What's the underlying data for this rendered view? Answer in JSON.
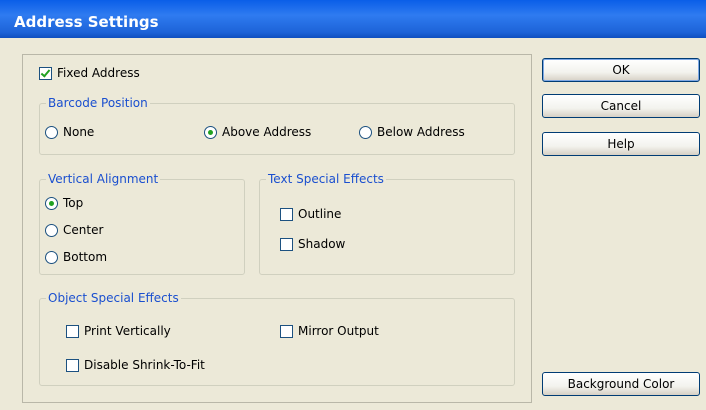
{
  "window": {
    "title": "Address Settings"
  },
  "fixed_address": {
    "label": "Fixed Address",
    "checked": true
  },
  "barcode_position": {
    "legend": "Barcode Position",
    "options": [
      {
        "label": "None",
        "checked": false
      },
      {
        "label": "Above Address",
        "checked": true
      },
      {
        "label": "Below Address",
        "checked": false
      }
    ]
  },
  "vertical_alignment": {
    "legend": "Vertical Alignment",
    "options": [
      {
        "label": "Top",
        "checked": true
      },
      {
        "label": "Center",
        "checked": false
      },
      {
        "label": "Bottom",
        "checked": false
      }
    ]
  },
  "text_special_effects": {
    "legend": "Text Special Effects",
    "options": [
      {
        "label": "Outline",
        "checked": false
      },
      {
        "label": "Shadow",
        "checked": false
      }
    ]
  },
  "object_special_effects": {
    "legend": "Object Special Effects",
    "options": [
      {
        "label": "Print Vertically",
        "checked": false
      },
      {
        "label": "Mirror Output",
        "checked": false
      },
      {
        "label": "Disable Shrink-To-Fit",
        "checked": false
      }
    ]
  },
  "buttons": {
    "ok": "OK",
    "cancel": "Cancel",
    "help": "Help",
    "background_color": "Background Color"
  },
  "colors": {
    "title_bar": "#1d63d8",
    "dialog_bg": "#ece9d8",
    "legend_text": "#1a4fcf",
    "check_mark": "#21a121"
  }
}
